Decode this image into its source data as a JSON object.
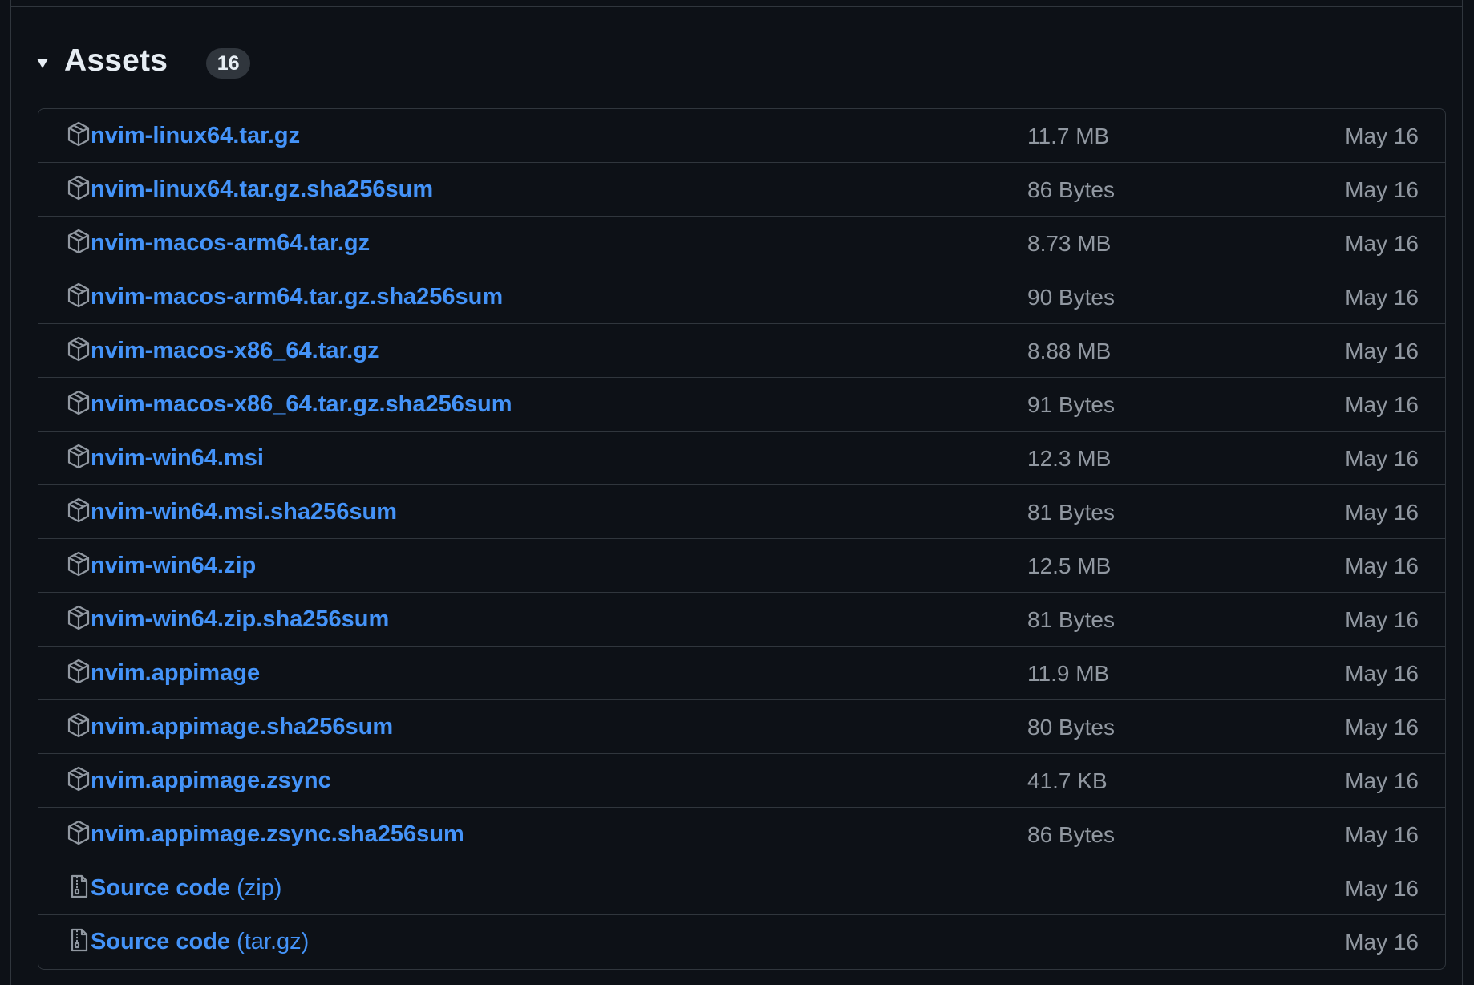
{
  "section": {
    "title": "Assets",
    "count": "16"
  },
  "assets": [
    {
      "name": "nvim-linux64.tar.gz",
      "suffix": "",
      "size": "11.7 MB",
      "date": "May 16",
      "icon": "package-icon"
    },
    {
      "name": "nvim-linux64.tar.gz.sha256sum",
      "suffix": "",
      "size": "86 Bytes",
      "date": "May 16",
      "icon": "package-icon"
    },
    {
      "name": "nvim-macos-arm64.tar.gz",
      "suffix": "",
      "size": "8.73 MB",
      "date": "May 16",
      "icon": "package-icon"
    },
    {
      "name": "nvim-macos-arm64.tar.gz.sha256sum",
      "suffix": "",
      "size": "90 Bytes",
      "date": "May 16",
      "icon": "package-icon"
    },
    {
      "name": "nvim-macos-x86_64.tar.gz",
      "suffix": "",
      "size": "8.88 MB",
      "date": "May 16",
      "icon": "package-icon"
    },
    {
      "name": "nvim-macos-x86_64.tar.gz.sha256sum",
      "suffix": "",
      "size": "91 Bytes",
      "date": "May 16",
      "icon": "package-icon"
    },
    {
      "name": "nvim-win64.msi",
      "suffix": "",
      "size": "12.3 MB",
      "date": "May 16",
      "icon": "package-icon"
    },
    {
      "name": "nvim-win64.msi.sha256sum",
      "suffix": "",
      "size": "81 Bytes",
      "date": "May 16",
      "icon": "package-icon"
    },
    {
      "name": "nvim-win64.zip",
      "suffix": "",
      "size": "12.5 MB",
      "date": "May 16",
      "icon": "package-icon"
    },
    {
      "name": "nvim-win64.zip.sha256sum",
      "suffix": "",
      "size": "81 Bytes",
      "date": "May 16",
      "icon": "package-icon"
    },
    {
      "name": "nvim.appimage",
      "suffix": "",
      "size": "11.9 MB",
      "date": "May 16",
      "icon": "package-icon"
    },
    {
      "name": "nvim.appimage.sha256sum",
      "suffix": "",
      "size": "80 Bytes",
      "date": "May 16",
      "icon": "package-icon"
    },
    {
      "name": "nvim.appimage.zsync",
      "suffix": "",
      "size": "41.7 KB",
      "date": "May 16",
      "icon": "package-icon"
    },
    {
      "name": "nvim.appimage.zsync.sha256sum",
      "suffix": "",
      "size": "86 Bytes",
      "date": "May 16",
      "icon": "package-icon"
    },
    {
      "name": "Source code",
      "suffix": "(zip)",
      "size": "",
      "date": "May 16",
      "icon": "file-zip-icon"
    },
    {
      "name": "Source code",
      "suffix": "(tar.gz)",
      "size": "",
      "date": "May 16",
      "icon": "file-zip-icon"
    }
  ],
  "colors": {
    "background": "#0d1117",
    "border": "#30363d",
    "link": "#4493f8",
    "muted": "#9198a1",
    "text": "#e6edf3",
    "badge": "#30363d"
  }
}
